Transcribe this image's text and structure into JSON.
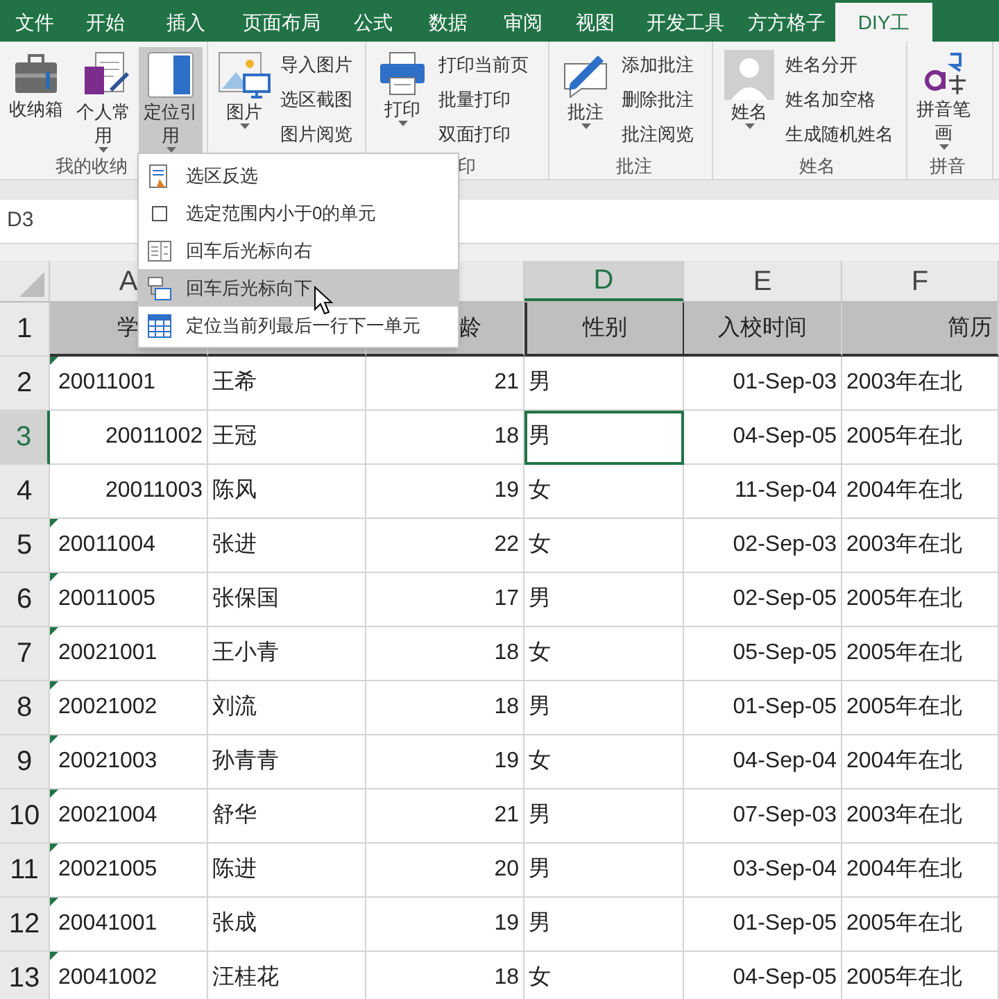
{
  "menu_tabs": [
    {
      "label": "文件",
      "selected": false
    },
    {
      "label": "开始",
      "selected": false
    },
    {
      "label": "插入",
      "selected": false
    },
    {
      "label": "页面布局",
      "selected": false
    },
    {
      "label": "公式",
      "selected": false
    },
    {
      "label": "数据",
      "selected": false
    },
    {
      "label": "审阅",
      "selected": false
    },
    {
      "label": "视图",
      "selected": false
    },
    {
      "label": "开发工具",
      "selected": false
    },
    {
      "label": "方方格子",
      "selected": false
    },
    {
      "label": "DIY工",
      "selected": true
    }
  ],
  "ribbon_groups": [
    {
      "label": "我的收纳",
      "items": [
        {
          "kind": "big",
          "label": "收纳箱",
          "caret": false,
          "pressed": false
        },
        {
          "kind": "big",
          "label": "个人常用",
          "caret": true,
          "pressed": false
        },
        {
          "kind": "big",
          "label": "定位引用",
          "caret": true,
          "pressed": true
        }
      ]
    },
    {
      "items": [
        {
          "kind": "big",
          "label": "图片",
          "caret": true,
          "pressed": false
        },
        {
          "kind": "small",
          "labels": [
            "导入图片",
            "选区截图",
            "图片阅览"
          ]
        }
      ]
    },
    {
      "label": "印",
      "items": [
        {
          "kind": "big",
          "label": "打印",
          "caret": true,
          "pressed": false
        },
        {
          "kind": "small",
          "labels": [
            "打印当前页",
            "批量打印",
            "双面打印"
          ]
        }
      ]
    },
    {
      "label": "批注",
      "items": [
        {
          "kind": "big",
          "label": "批注",
          "caret": true,
          "pressed": false
        },
        {
          "kind": "small",
          "labels": [
            "添加批注",
            "删除批注",
            "批注阅览"
          ]
        }
      ]
    },
    {
      "label": "姓名",
      "items": [
        {
          "kind": "big",
          "label": "姓名",
          "caret": true,
          "pressed": false
        },
        {
          "kind": "small",
          "labels": [
            "姓名分开",
            "姓名加空格",
            "生成随机姓名"
          ]
        }
      ]
    },
    {
      "label": "拼音",
      "items": [
        {
          "kind": "big",
          "label": "拼音笔画",
          "caret": true,
          "pressed": false
        }
      ]
    }
  ],
  "dropdown_menu": [
    {
      "label": "选区反选",
      "selected": false
    },
    {
      "label": "选定范围内小于0的单元",
      "selected": false
    },
    {
      "label": "回车后光标向右",
      "selected": false
    },
    {
      "label": "回车后光标向下",
      "selected": true
    },
    {
      "label": "定位当前列最后一行下一单元",
      "selected": false
    }
  ],
  "name_box": "D3",
  "columns": [
    {
      "label": "A",
      "selected": false
    },
    {
      "label": "D",
      "selected": true
    },
    {
      "label": "E",
      "selected": false
    },
    {
      "label": "F",
      "selected": false
    }
  ],
  "header_row": {
    "number": "1",
    "cells": [
      "学",
      "",
      "龄",
      "性别",
      "入校时间",
      "简历"
    ]
  },
  "rows": [
    {
      "number": "2",
      "selected": false,
      "id": "20011001",
      "kind": "text",
      "name": "王希",
      "age": "21",
      "gender": "男",
      "date": "01-Sep-03",
      "resume": "2003年在北"
    },
    {
      "number": "3",
      "selected": true,
      "id": "20011002",
      "kind": "number",
      "name": "王冠",
      "age": "18",
      "gender": "男",
      "date": "04-Sep-05",
      "resume": "2005年在北"
    },
    {
      "number": "4",
      "selected": false,
      "id": "20011003",
      "kind": "number",
      "name": "陈风",
      "age": "19",
      "gender": "女",
      "date": "11-Sep-04",
      "resume": "2004年在北"
    },
    {
      "number": "5",
      "selected": false,
      "id": "20011004",
      "kind": "text",
      "name": "张进",
      "age": "22",
      "gender": "女",
      "date": "02-Sep-03",
      "resume": "2003年在北"
    },
    {
      "number": "6",
      "selected": false,
      "id": "20011005",
      "kind": "text",
      "name": "张保国",
      "age": "17",
      "gender": "男",
      "date": "02-Sep-05",
      "resume": "2005年在北"
    },
    {
      "number": "7",
      "selected": false,
      "id": "20021001",
      "kind": "text",
      "name": "王小青",
      "age": "18",
      "gender": "女",
      "date": "05-Sep-05",
      "resume": "2005年在北"
    },
    {
      "number": "8",
      "selected": false,
      "id": "20021002",
      "kind": "text",
      "name": "刘流",
      "age": "18",
      "gender": "男",
      "date": "01-Sep-05",
      "resume": "2005年在北"
    },
    {
      "number": "9",
      "selected": false,
      "id": "20021003",
      "kind": "text",
      "name": "孙青青",
      "age": "19",
      "gender": "女",
      "date": "04-Sep-04",
      "resume": "2004年在北"
    },
    {
      "number": "10",
      "selected": false,
      "id": "20021004",
      "kind": "text",
      "name": "舒华",
      "age": "21",
      "gender": "男",
      "date": "07-Sep-03",
      "resume": "2003年在北"
    },
    {
      "number": "11",
      "selected": false,
      "id": "20021005",
      "kind": "text",
      "name": "陈进",
      "age": "20",
      "gender": "男",
      "date": "03-Sep-04",
      "resume": "2004年在北"
    },
    {
      "number": "12",
      "selected": false,
      "id": "20041001",
      "kind": "text",
      "name": "张成",
      "age": "19",
      "gender": "男",
      "date": "01-Sep-05",
      "resume": "2005年在北"
    },
    {
      "number": "13",
      "selected": false,
      "id": "20041002",
      "kind": "text",
      "name": "汪桂花",
      "age": "18",
      "gender": "女",
      "date": "04-Sep-05",
      "resume": "2005年在北"
    }
  ]
}
